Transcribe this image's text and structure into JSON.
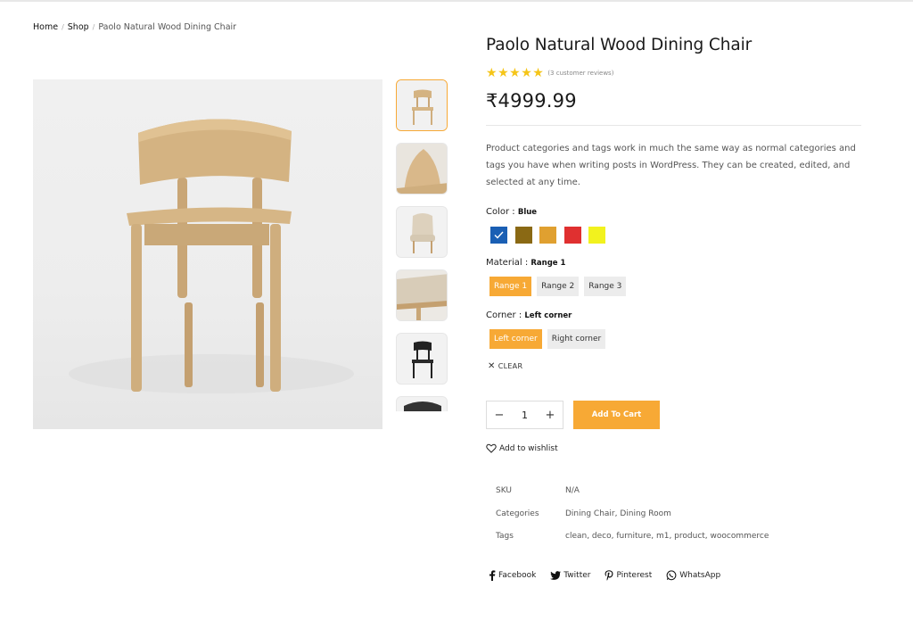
{
  "breadcrumb": {
    "home": "Home",
    "shop": "Shop",
    "current": "Paolo Natural Wood Dining Chair",
    "sep": "/"
  },
  "product": {
    "title": "Paolo Natural Wood Dining Chair",
    "rating": 5,
    "review_text": "(3 customer reviews)",
    "price": "₹4999.99",
    "description": "Product categories and tags work in much the same way as normal categories and tags you have when writing posts in WordPress. They can be created, edited, and selected at any time."
  },
  "gallery": {
    "thumbnail_count": 6,
    "active_index": 0
  },
  "attributes": {
    "color": {
      "label": "Color",
      "selected": "Blue",
      "swatches": [
        "#1a5fb4",
        "#8a6914",
        "#e0a030",
        "#e03030",
        "#f2f21e"
      ]
    },
    "material": {
      "label": "Material",
      "selected": "Range 1",
      "options": [
        "Range 1",
        "Range 2",
        "Range 3"
      ]
    },
    "corner": {
      "label": "Corner",
      "selected": "Left corner",
      "options": [
        "Left corner",
        "Right corner"
      ]
    },
    "clear_label": "CLEAR",
    "colon": ":"
  },
  "cart": {
    "quantity": "1",
    "minus": "−",
    "plus": "+",
    "button_label": "Add To Cart"
  },
  "wishlist": {
    "label": "Add to wishlist"
  },
  "meta": {
    "sku_key": "SKU",
    "sku_val": "N/A",
    "categories_key": "Categories",
    "categories_val": "Dining Chair, Dining Room",
    "tags_key": "Tags",
    "tags_val": "clean, deco, furniture, m1, product, woocommerce"
  },
  "share": {
    "facebook": "Facebook",
    "twitter": "Twitter",
    "pinterest": "Pinterest",
    "whatsapp": "WhatsApp"
  },
  "colors": {
    "accent": "#f7a935",
    "star": "#f5c518"
  }
}
